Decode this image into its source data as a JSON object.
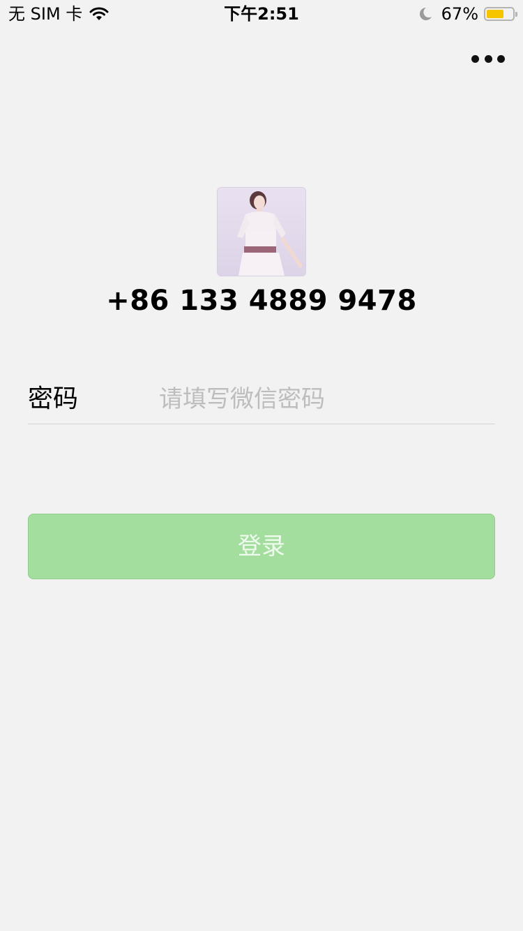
{
  "status_bar": {
    "carrier": "无 SIM 卡",
    "time": "下午2:51",
    "battery_percent": "67%",
    "battery_level": 0.67,
    "icons": [
      "wifi-icon",
      "moon-icon",
      "battery-icon"
    ]
  },
  "header": {
    "more_icon": "more-dots-icon"
  },
  "profile": {
    "avatar": "avatar-photo",
    "phone": "+86 133 4889 9478"
  },
  "password": {
    "label": "密码",
    "placeholder": "请填写微信密码",
    "value": ""
  },
  "login": {
    "label": "登录"
  },
  "colors": {
    "background": "#f2f2f2",
    "button_disabled_green": "#a3de9e",
    "battery_yellow": "#f6c500",
    "placeholder_gray": "#bdbdbd"
  }
}
